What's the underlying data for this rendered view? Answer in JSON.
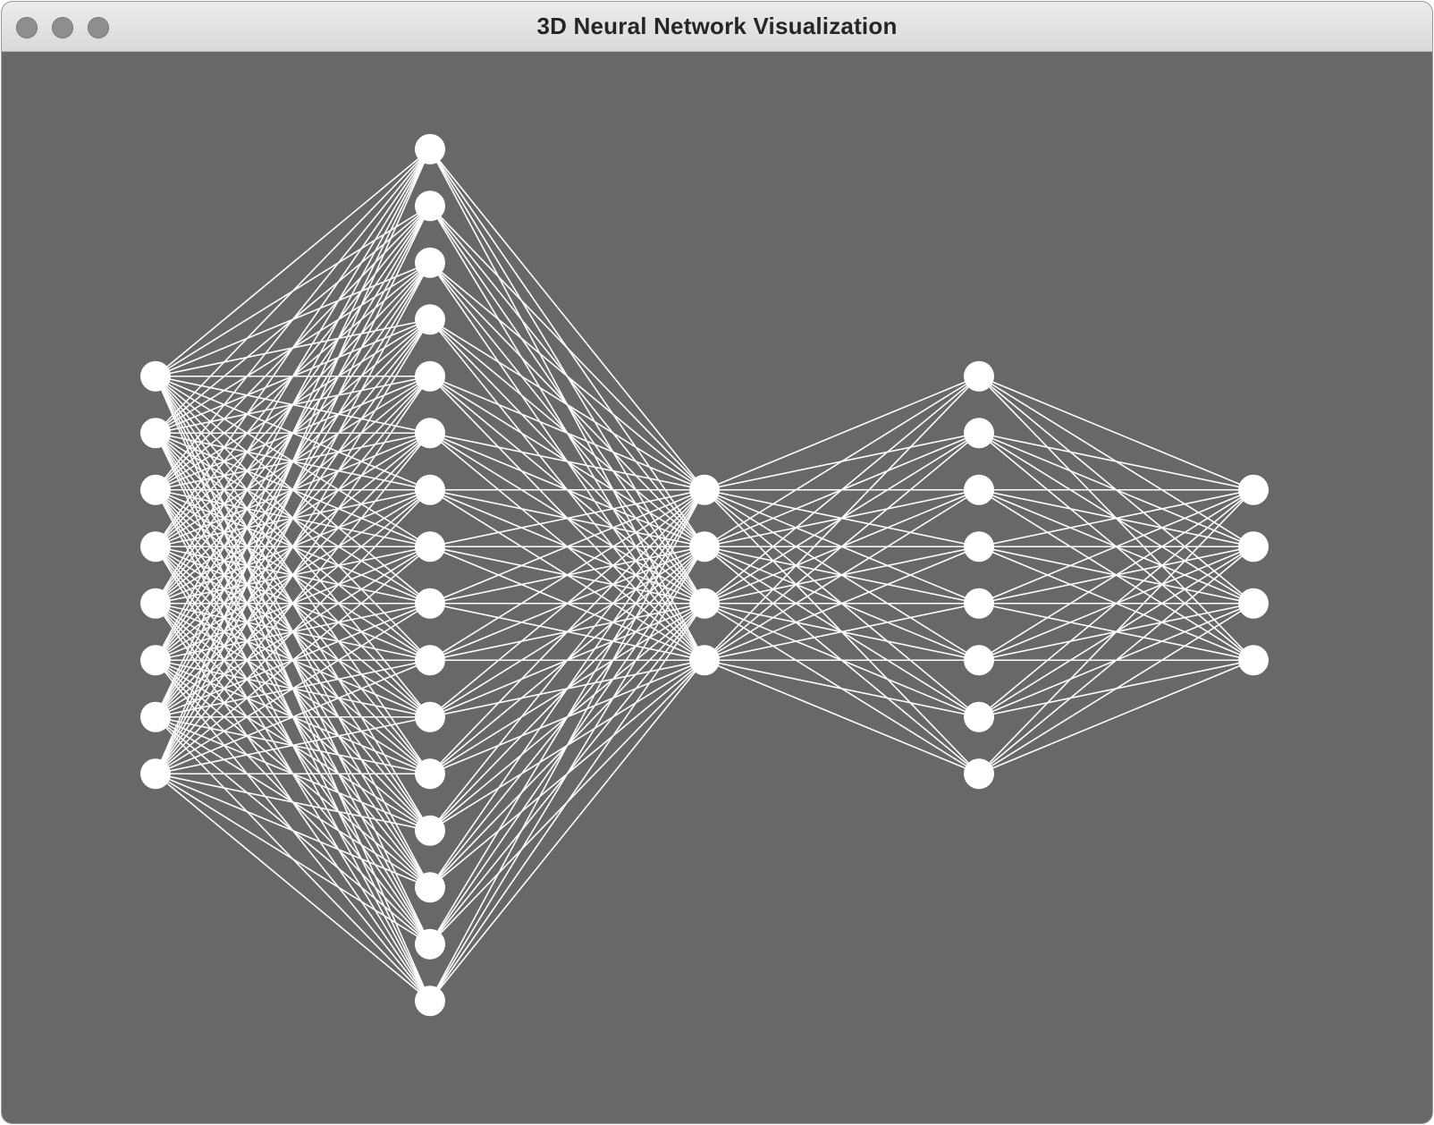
{
  "window": {
    "title": "3D Neural Network Visualization",
    "controls": [
      "close-button",
      "minimize-button",
      "zoom-button"
    ]
  },
  "network": {
    "background_color": "#686868",
    "node_color": "#ffffff",
    "edge_color": "#ffffff",
    "fully_connected": true,
    "layers": [
      {
        "index": 0,
        "node_count": 8
      },
      {
        "index": 1,
        "node_count": 16
      },
      {
        "index": 2,
        "node_count": 4
      },
      {
        "index": 3,
        "node_count": 8
      },
      {
        "index": 4,
        "node_count": 4
      }
    ]
  }
}
